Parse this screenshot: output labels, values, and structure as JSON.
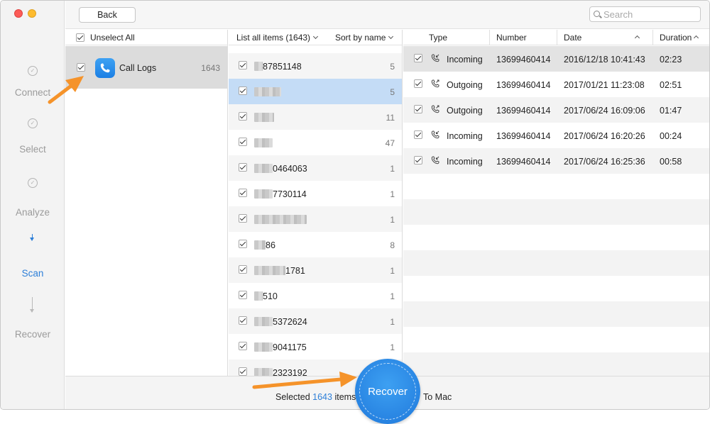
{
  "window": {
    "colors": {
      "accent": "#2d7fd8",
      "annotation": "#f5932a"
    }
  },
  "steps": [
    {
      "label": "Connect",
      "state": "done"
    },
    {
      "label": "Select",
      "state": "done"
    },
    {
      "label": "Analyze",
      "state": "done"
    },
    {
      "label": "Scan",
      "state": "active"
    },
    {
      "label": "Recover",
      "state": "pending"
    }
  ],
  "toolbar": {
    "back_label": "Back",
    "search_placeholder": "Search"
  },
  "categories": {
    "unselect_all_label": "Unselect All",
    "items": [
      {
        "name": "Call Logs",
        "count": "1643",
        "icon": "phone-icon",
        "checked": true
      }
    ]
  },
  "list": {
    "header_label": "List all items (1643)",
    "sort_label": "Sort by name",
    "rows": [
      {
        "number": "87851148",
        "count": "5"
      },
      {
        "number": "",
        "count": "5"
      },
      {
        "number": "",
        "count": "11"
      },
      {
        "number": "",
        "count": "47"
      },
      {
        "number": "0464063",
        "count": "1"
      },
      {
        "number": "7730114",
        "count": "1"
      },
      {
        "number": "",
        "count": "1"
      },
      {
        "number": "86",
        "count": "8"
      },
      {
        "number": "1781",
        "count": "1"
      },
      {
        "number": "510",
        "count": "1"
      },
      {
        "number": "5372624",
        "count": "1"
      },
      {
        "number": "9041175",
        "count": "1"
      },
      {
        "number": "2323192",
        "count": ""
      }
    ]
  },
  "details": {
    "columns": {
      "type": "Type",
      "number": "Number",
      "date": "Date",
      "duration": "Duration"
    },
    "rows": [
      {
        "type": "Incoming",
        "number": "13699460414",
        "date": "2016/12/18 10:41:43",
        "duration": "02:23"
      },
      {
        "type": "Outgoing",
        "number": "13699460414",
        "date": "2017/01/21 11:23:08",
        "duration": "02:51"
      },
      {
        "type": "Outgoing",
        "number": "13699460414",
        "date": "2017/06/24 16:09:06",
        "duration": "01:47"
      },
      {
        "type": "Incoming",
        "number": "13699460414",
        "date": "2017/06/24 16:20:26",
        "duration": "00:24"
      },
      {
        "type": "Incoming",
        "number": "13699460414",
        "date": "2017/06/24 16:25:36",
        "duration": "00:58"
      }
    ]
  },
  "footer": {
    "selected_prefix": "Selected",
    "selected_count": "1643",
    "selected_suffix": "items",
    "recover_label": "Recover",
    "to_mac": "To Mac"
  }
}
